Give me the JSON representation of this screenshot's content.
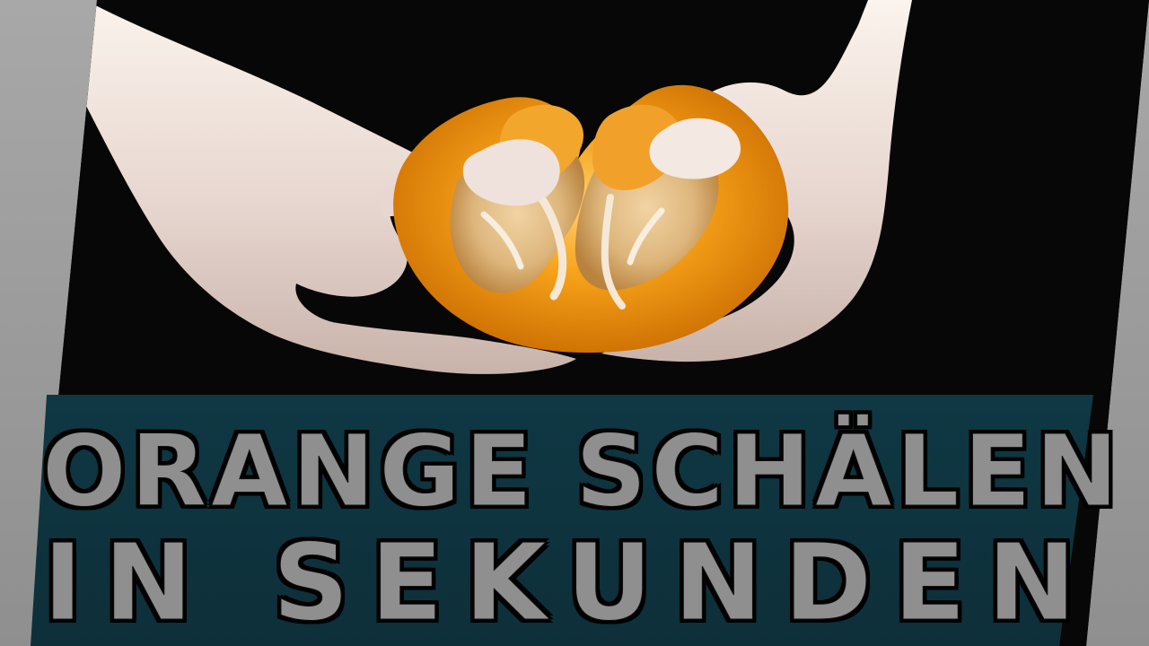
{
  "thumbnail": {
    "headline_line_1": "ORANGE SCHÄLEN",
    "headline_line_2": "IN SEKUNDEN"
  },
  "palette": {
    "background_gray": "#a3a3a3",
    "photo_black": "#080808",
    "caption_teal": "#0f3844",
    "text_gray": "#8f8f8f",
    "orange_peel": "#f5a019"
  },
  "image": {
    "subject": "hands-peeling-orange"
  }
}
